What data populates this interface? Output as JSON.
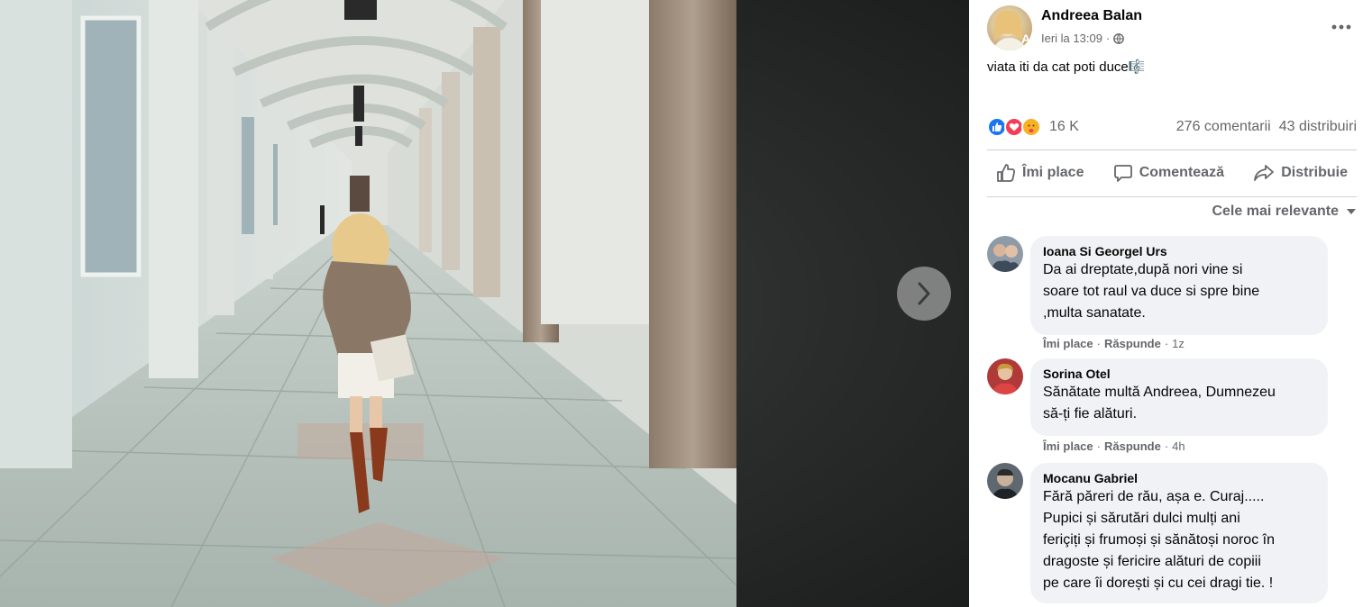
{
  "post": {
    "author": "Andreea Balan",
    "timestamp": "Ieri la 13:09",
    "separator": "·",
    "privacy_icon": "globe-icon",
    "text": "viata iti da cat poti duce",
    "text_emoji": "🎼"
  },
  "stats": {
    "reaction_icons": [
      "like-icon",
      "love-icon",
      "care-icon"
    ],
    "reaction_count": "16 K",
    "comments": "276 comentarii",
    "shares": "43 distribuiri"
  },
  "actions": {
    "like": "Îmi place",
    "comment": "Comentează",
    "share": "Distribuie"
  },
  "sort": {
    "label": "Cele mai relevante"
  },
  "comments": [
    {
      "name": "Ioana Si Georgel Urs",
      "lines": [
        "Da ai dreptate,după nori vine si",
        "soare tot raul va duce si spre bine",
        ",multa sanatate."
      ],
      "like": "Îmi place",
      "reply": "Răspunde",
      "time": "1z"
    },
    {
      "name": "Sorina Otel",
      "lines": [
        "Sănătate multă Andreea, Dumnezeu",
        "să-ți fie alături."
      ],
      "like": "Îmi place",
      "reply": "Răspunde",
      "time": "4h"
    },
    {
      "name": "Mocanu Gabriel",
      "lines": [
        "Fără păreri de rău, așa e. Curaj.....",
        "Pupici și sărutări dulci mulți ani",
        "feriçiți și frumoși și sănătoși noroc în",
        "dragoste și fericire alături de copiii",
        "pe care îi dorești și cu cei dragi tie. !"
      ],
      "like": "",
      "reply": "",
      "time": ""
    }
  ],
  "colors": {
    "like_blue": "#1877f2",
    "love_red": "#f33e58",
    "care_yellow": "#f7b125",
    "muted_text": "#65676b",
    "bubble_bg": "#f0f2f5"
  }
}
